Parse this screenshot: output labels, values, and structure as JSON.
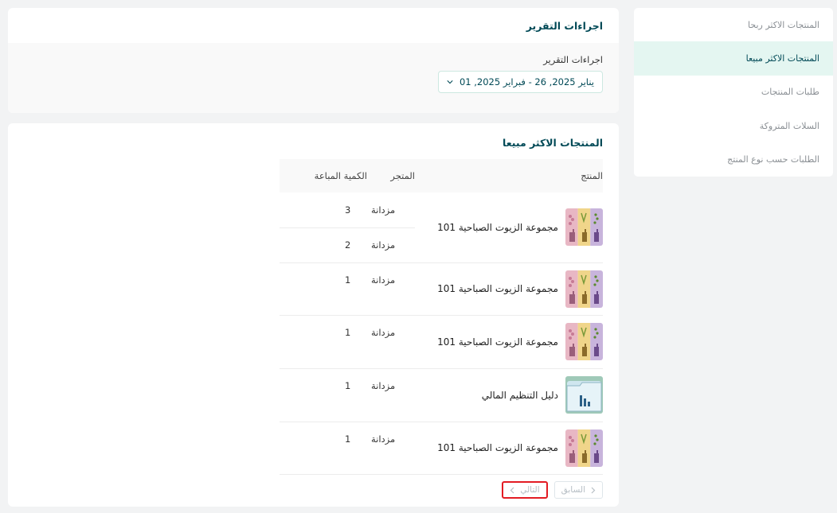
{
  "sidebar": {
    "items": [
      {
        "label": "المنتجات الاكثر ربحا",
        "active": false
      },
      {
        "label": "المنتجات الاكثر مبيعا",
        "active": true
      },
      {
        "label": "طلبات المنتجات",
        "active": false
      },
      {
        "label": "السلات المتروكة",
        "active": false
      },
      {
        "label": "الطلبات حسب نوع المنتج",
        "active": false
      }
    ]
  },
  "settings": {
    "title": "اجراءات التقرير",
    "field_label": "اجراءات التقرير",
    "date_range": "يناير 2025, 26 - فبراير 2025, 01"
  },
  "products": {
    "title": "المنتجات الاكثر مبيعا",
    "columns": {
      "product": "المنتج",
      "store": "المتجر",
      "qty": "الكمية المباعة"
    },
    "rows": [
      {
        "name": "مجموعة الزيوت الصباحية 101",
        "icon": "oils-bottles-image",
        "store": "مزدانة",
        "qty": "3",
        "store2": "مزدانة",
        "qty2": "2"
      },
      {
        "name": "مجموعة الزيوت الصباحية 101",
        "icon": "oils-bottles-image",
        "store": "مزدانة",
        "qty": "1"
      },
      {
        "name": "مجموعة الزيوت الصباحية 101",
        "icon": "oils-bottles-image",
        "store": "مزدانة",
        "qty": "1"
      },
      {
        "name": "دليل التنظيم المالي",
        "icon": "finance-folder-image",
        "store": "مزدانة",
        "qty": "1"
      },
      {
        "name": "مجموعة الزيوت الصباحية 101",
        "icon": "oils-bottles-image",
        "store": "مزدانة",
        "qty": "1"
      }
    ],
    "pager": {
      "prev": "السابق",
      "next": "التالي"
    }
  },
  "colors": {
    "accent": "#004956",
    "active_bg": "#e4f6f1",
    "highlight": "#e31b23"
  }
}
